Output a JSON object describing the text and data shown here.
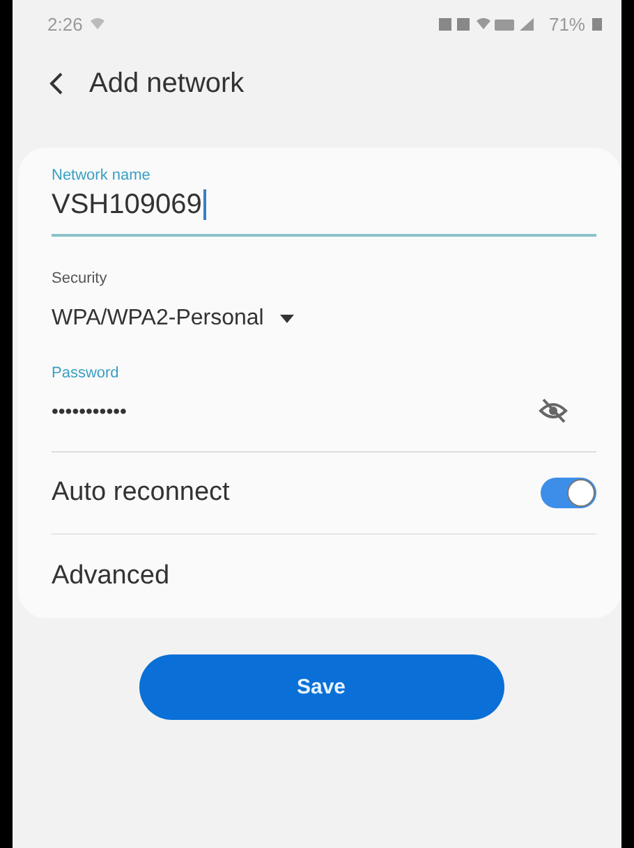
{
  "status_bar": {
    "time": "2:26",
    "battery": "71%"
  },
  "header": {
    "title": "Add network"
  },
  "form": {
    "network_name": {
      "label": "Network name",
      "value": "VSH109069",
      "focused": true
    },
    "security": {
      "label": "Security",
      "value": "WPA/WPA2-Personal"
    },
    "password": {
      "label": "Password",
      "value": "•••••••••••"
    },
    "settings": [
      {
        "kind": "toggle",
        "label": "Auto reconnect",
        "on": true
      },
      {
        "kind": "link",
        "label": "Advanced"
      }
    ]
  },
  "buttons": [
    "Save"
  ]
}
